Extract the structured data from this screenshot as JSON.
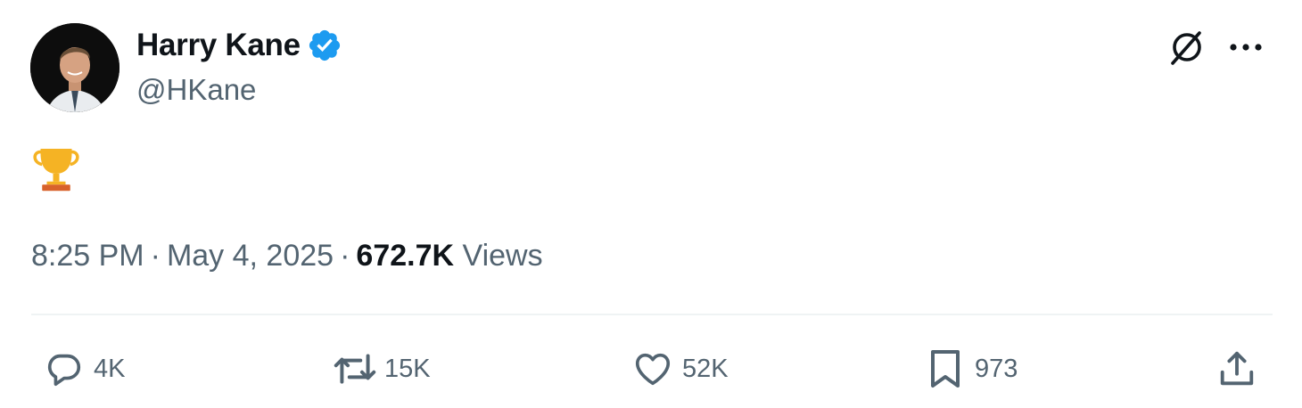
{
  "author": {
    "display_name": "Harry Kane",
    "handle": "@HKane",
    "verified": true
  },
  "tweet": {
    "emoji": "trophy-emoji"
  },
  "meta": {
    "time": "8:25 PM",
    "separator": "·",
    "date": "May 4, 2025",
    "views_count": "672.7K",
    "views_label": "Views"
  },
  "actions": {
    "replies": "4K",
    "reposts": "15K",
    "likes": "52K",
    "bookmarks": "973"
  },
  "icons": {
    "top_right": [
      "grok-icon",
      "more-icon"
    ],
    "action_bar": [
      "reply-icon",
      "repost-icon",
      "like-icon",
      "bookmark-icon",
      "share-icon"
    ]
  },
  "colors": {
    "verified_badge": "#1d9bf0",
    "primary_text": "#0f1419",
    "secondary_text": "#536471",
    "divider": "#eff3f4"
  }
}
